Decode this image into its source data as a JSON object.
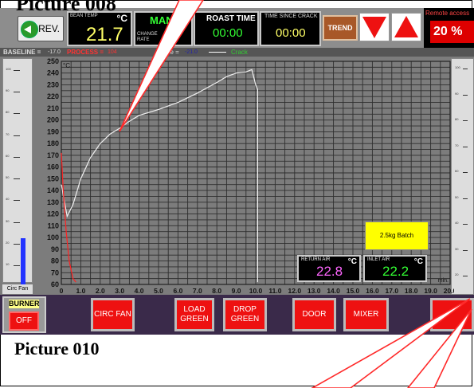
{
  "captions": {
    "top": "Picture 008",
    "bottom": "Picture 010"
  },
  "header": {
    "prev_label": "PREV.",
    "bean_temp": {
      "label": "BEAN TEMP",
      "unit": "°C",
      "value": "21.7"
    },
    "mode": {
      "value": "MAN",
      "change_rate_label": "CHANGE RATE"
    },
    "roast_time": {
      "label": "ROAST TIME",
      "value": "00:00"
    },
    "time_since_crack": {
      "label": "TIME SINCE CRACK",
      "value": "00:00"
    },
    "trend_label": "TREND",
    "remote": {
      "label": "Remote access",
      "value": "20 %"
    }
  },
  "legend": {
    "baseline_label": "BASELINE =",
    "baseline_value": "-17.0",
    "process_label": "PROCESS =",
    "process_value": "104",
    "difference_label": "nce =",
    "difference_value": "-21.0",
    "crack_label": "Crack"
  },
  "left_slider": {
    "label": "Circ Fan",
    "level_fraction": 0.22,
    "tick_labels": [
      "100",
      "90",
      "80",
      "70",
      "60",
      "50",
      "40",
      "30",
      "20",
      "10"
    ]
  },
  "right_slider": {
    "tick_labels": [
      "100",
      "90",
      "80",
      "70",
      "60",
      "50",
      "40",
      "30",
      "20"
    ]
  },
  "batch_label": "2.5kg Batch",
  "return_air": {
    "label": "RETURN AIR",
    "unit": "°C",
    "value": "22.8"
  },
  "inlet_air": {
    "label": "INLET AIR",
    "unit": "°C",
    "value": "22.2"
  },
  "buttons": {
    "burner_label": "BURNER",
    "burner_state": "OFF",
    "circ_fan": "CIRC FAN",
    "load_green": "LOAD GREEN",
    "drop_green": "DROP GREEN",
    "door": "DOOR",
    "mixer": "MIXER"
  },
  "chart_data": {
    "type": "line",
    "y_unit": "°C",
    "x_unit": "min.",
    "xlim": [
      0,
      20
    ],
    "ylim": [
      60,
      250
    ],
    "x_ticks": [
      "0",
      "1.0",
      "2.0",
      "3.0",
      "4.0",
      "5.0",
      "6.0",
      "7.0",
      "8.0",
      "9.0",
      "10.0",
      "11.0",
      "12.0",
      "13.0",
      "14.0",
      "15.0",
      "16.0",
      "17.0",
      "18.0",
      "19.0",
      "20.0"
    ],
    "y_ticks": [
      60,
      70,
      80,
      90,
      100,
      110,
      120,
      130,
      140,
      150,
      160,
      170,
      180,
      190,
      200,
      210,
      220,
      230,
      240,
      250
    ],
    "grid": true,
    "series": [
      {
        "color": "#f0f0f0",
        "x": [
          0.0,
          0.3,
          0.6,
          1.0,
          1.5,
          2.0,
          2.5,
          3.0,
          3.5,
          4.0,
          5.0,
          6.0,
          7.0,
          8.0,
          8.5,
          9.0,
          9.5,
          9.8,
          10.0,
          10.1,
          10.1
        ],
        "y": [
          145,
          118,
          128,
          150,
          168,
          180,
          188,
          193,
          199,
          204,
          209,
          215,
          223,
          232,
          237,
          240,
          241,
          243,
          230,
          226,
          62
        ]
      },
      {
        "color": "#ff2222",
        "x": [
          0.0,
          0.1,
          0.25,
          0.4,
          0.6,
          0.75
        ],
        "y": [
          172,
          140,
          105,
          80,
          65,
          62
        ]
      }
    ]
  },
  "colors": {
    "grid_bg": "#7c7c7c",
    "grid_line": "#2e2e2e",
    "button_red": "#ee1111",
    "value_yellow": "#ffff66",
    "value_green": "#33ff33",
    "return_air_color": "#ff66ff"
  }
}
